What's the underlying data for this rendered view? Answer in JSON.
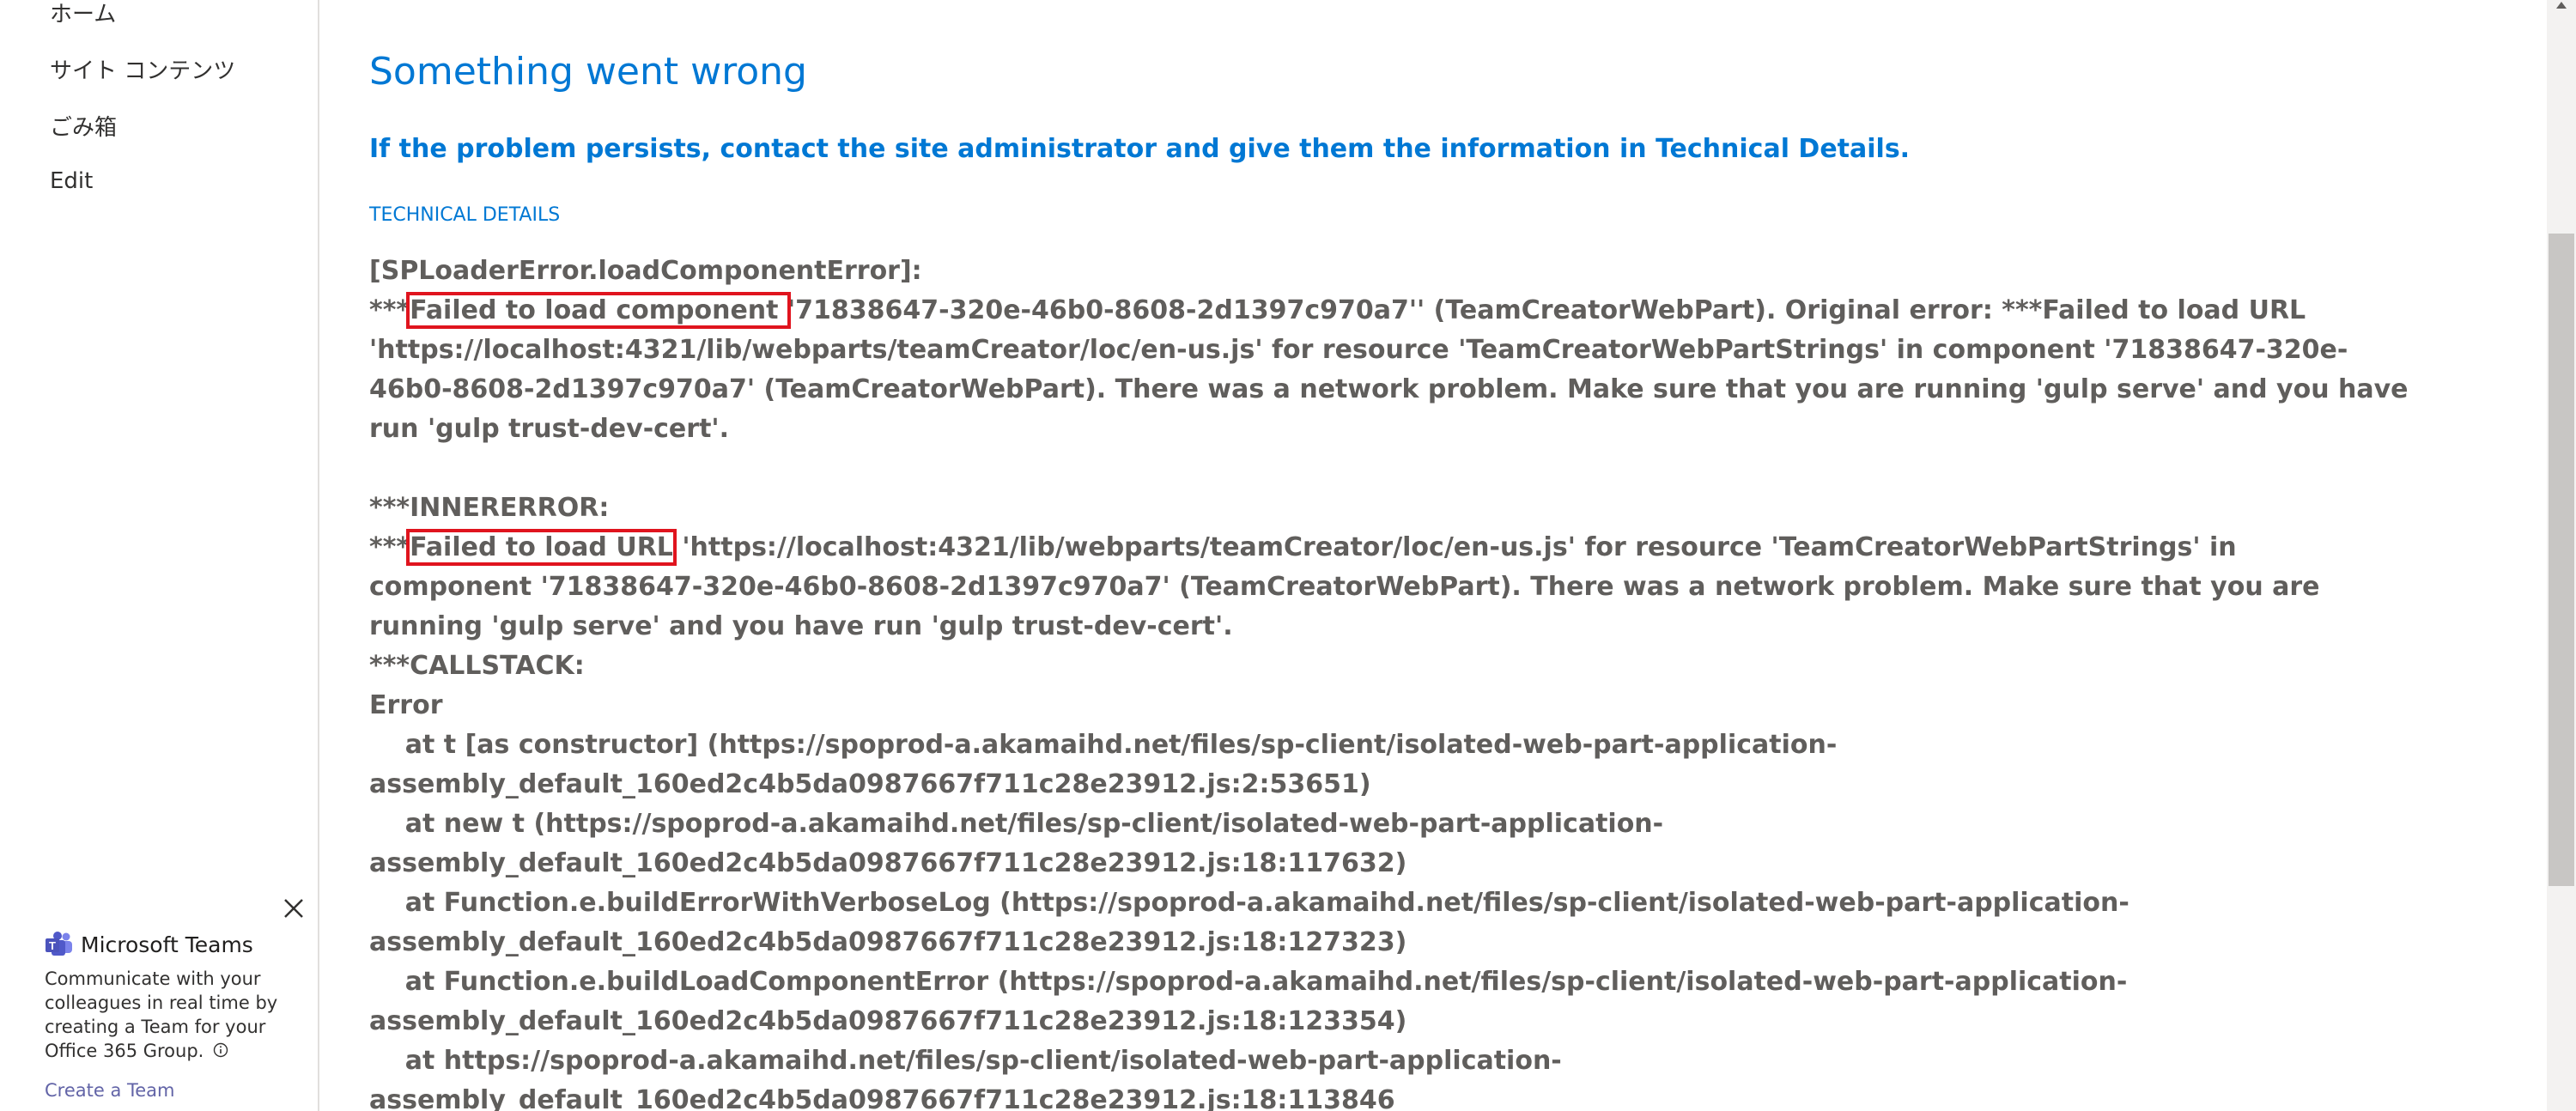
{
  "nav": {
    "items": [
      {
        "label": "ホーム"
      },
      {
        "label": "サイト コンテンツ"
      },
      {
        "label": "ごみ箱"
      },
      {
        "label": "Edit"
      }
    ]
  },
  "teams": {
    "title": "Microsoft Teams",
    "description": "Communicate with your colleagues in real time by creating a Team for your Office 365 Group.",
    "create_label": "Create a Team",
    "brand_color": "#6264a7"
  },
  "error": {
    "title": "Something went wrong",
    "subtitle": "If the problem persists, contact the site administrator and give them the information in Technical Details.",
    "tech_label": "TECHNICAL DETAILS",
    "accent_color": "#0078d4",
    "highlight_color": "#e0141e",
    "lines": [
      {
        "pre": "[SPLoaderError.loadComponentError]:",
        "hl": "",
        "post": ""
      },
      {
        "pre": "***",
        "hl": "Failed to load component ",
        "post": "'71838647-320e-46b0-8608-2d1397c970a7'' (TeamCreatorWebPart). Original error: ***Failed to load URL"
      },
      {
        "pre": "'https://localhost:4321/lib/webparts/teamCreator/loc/en-us.js' for resource 'TeamCreatorWebPartStrings' in component '71838647-320e-",
        "hl": "",
        "post": ""
      },
      {
        "pre": "46b0-8608-2d1397c970a7' (TeamCreatorWebPart). There was a network problem. Make sure that you are running 'gulp serve' and you have",
        "hl": "",
        "post": ""
      },
      {
        "pre": "run 'gulp trust-dev-cert'.",
        "hl": "",
        "post": ""
      },
      {
        "pre": "",
        "hl": "",
        "post": ""
      },
      {
        "pre": "***INNERERROR:",
        "hl": "",
        "post": ""
      },
      {
        "pre": "***",
        "hl": "Failed to load URL",
        "post": " 'https://localhost:4321/lib/webparts/teamCreator/loc/en-us.js' for resource 'TeamCreatorWebPartStrings' in"
      },
      {
        "pre": "component '71838647-320e-46b0-8608-2d1397c970a7' (TeamCreatorWebPart). There was a network problem. Make sure that you are",
        "hl": "",
        "post": ""
      },
      {
        "pre": "running 'gulp serve' and you have run 'gulp trust-dev-cert'.",
        "hl": "",
        "post": ""
      },
      {
        "pre": "***CALLSTACK:",
        "hl": "",
        "post": ""
      },
      {
        "pre": "Error",
        "hl": "",
        "post": ""
      },
      {
        "pre": "    at t [as constructor] (https://spoprod-a.akamaihd.net/files/sp-client/isolated-web-part-application-",
        "hl": "",
        "post": ""
      },
      {
        "pre": "assembly_default_160ed2c4b5da0987667f711c28e23912.js:2:53651)",
        "hl": "",
        "post": ""
      },
      {
        "pre": "    at new t (https://spoprod-a.akamaihd.net/files/sp-client/isolated-web-part-application-",
        "hl": "",
        "post": ""
      },
      {
        "pre": "assembly_default_160ed2c4b5da0987667f711c28e23912.js:18:117632)",
        "hl": "",
        "post": ""
      },
      {
        "pre": "    at Function.e.buildErrorWithVerboseLog (https://spoprod-a.akamaihd.net/files/sp-client/isolated-web-part-application-",
        "hl": "",
        "post": ""
      },
      {
        "pre": "assembly_default_160ed2c4b5da0987667f711c28e23912.js:18:127323)",
        "hl": "",
        "post": ""
      },
      {
        "pre": "    at Function.e.buildLoadComponentError (https://spoprod-a.akamaihd.net/files/sp-client/isolated-web-part-application-",
        "hl": "",
        "post": ""
      },
      {
        "pre": "assembly_default_160ed2c4b5da0987667f711c28e23912.js:18:123354)",
        "hl": "",
        "post": ""
      },
      {
        "pre": "    at https://spoprod-a.akamaihd.net/files/sp-client/isolated-web-part-application-",
        "hl": "",
        "post": ""
      },
      {
        "pre": "assembly_default_160ed2c4b5da0987667f711c28e23912.js:18:113846",
        "hl": "",
        "post": ""
      }
    ]
  }
}
